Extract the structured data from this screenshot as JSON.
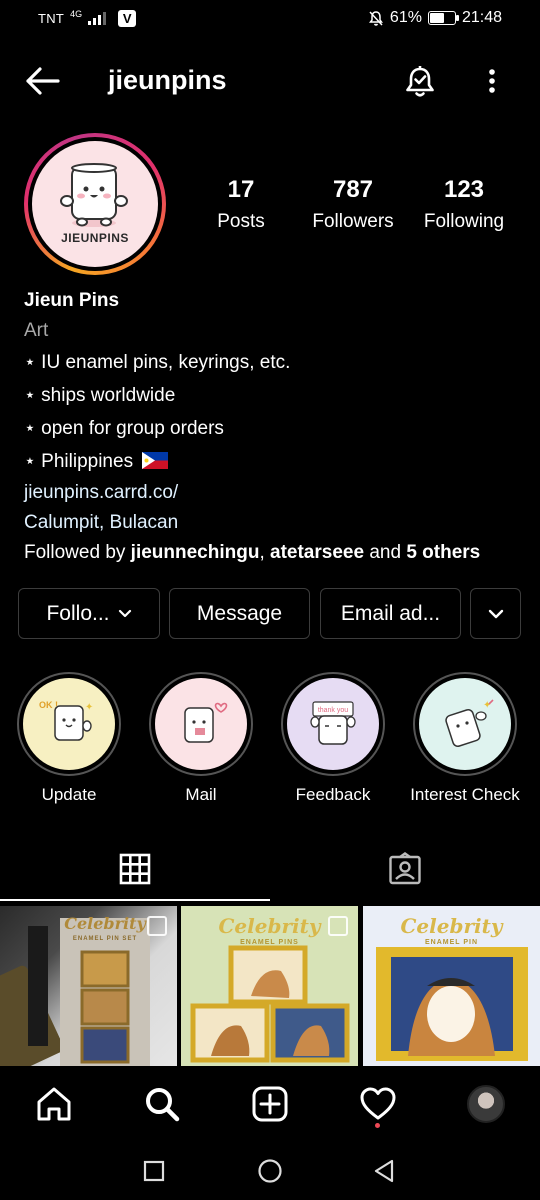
{
  "status_bar": {
    "carrier": "TNT",
    "network": "4G",
    "battery_percent": "61%",
    "battery_level": 0.61,
    "time": "21:48"
  },
  "header": {
    "username": "jieunpins"
  },
  "profile": {
    "avatar_logo_text": "JIEUNPINS",
    "stats": [
      {
        "value": "17",
        "label": "Posts"
      },
      {
        "value": "787",
        "label": "Followers"
      },
      {
        "value": "123",
        "label": "Following"
      }
    ]
  },
  "bio": {
    "name": "Jieun Pins",
    "category": "Art",
    "lines": [
      "⋆ IU enamel pins, keyrings, etc.",
      "⋆ ships worldwide",
      "⋆ open for group orders",
      "⋆ Philippines"
    ],
    "link": "jieunpins.carrd.co/",
    "location": "Calumpit, Bulacan",
    "followed_by_prefix": "Followed by ",
    "followed_by_1": "jieunnechingu",
    "followed_by_sep": ", ",
    "followed_by_2": "atetarseee",
    "followed_by_and": " and ",
    "followed_by_others": "5 others"
  },
  "actions": {
    "follow_label": "Follo...",
    "message_label": "Message",
    "email_label": "Email ad..."
  },
  "highlights": [
    {
      "label": "Update",
      "bg": "#f7f0c2",
      "badge": "OK !"
    },
    {
      "label": "Mail",
      "bg": "#fbe3e6"
    },
    {
      "label": "Feedback",
      "bg": "#e6dcf3",
      "badge": "thank you"
    },
    {
      "label": "Interest Check",
      "bg": "#dff3ef"
    }
  ],
  "posts": [
    {
      "title": "Celebrity",
      "subtitle": "ENAMEL PIN SET"
    },
    {
      "title": "Celebrity",
      "subtitle": "ENAMEL PINS"
    },
    {
      "title": "Celebrity",
      "subtitle": "ENAMEL PIN"
    }
  ],
  "colors": {
    "background": "#000000",
    "text": "#ffffff",
    "muted": "#a8a8a8",
    "link": "#e0f1ff",
    "button_border": "#3c3c3c",
    "notification": "#ed4956",
    "pin_gold": "#d9b84a"
  }
}
